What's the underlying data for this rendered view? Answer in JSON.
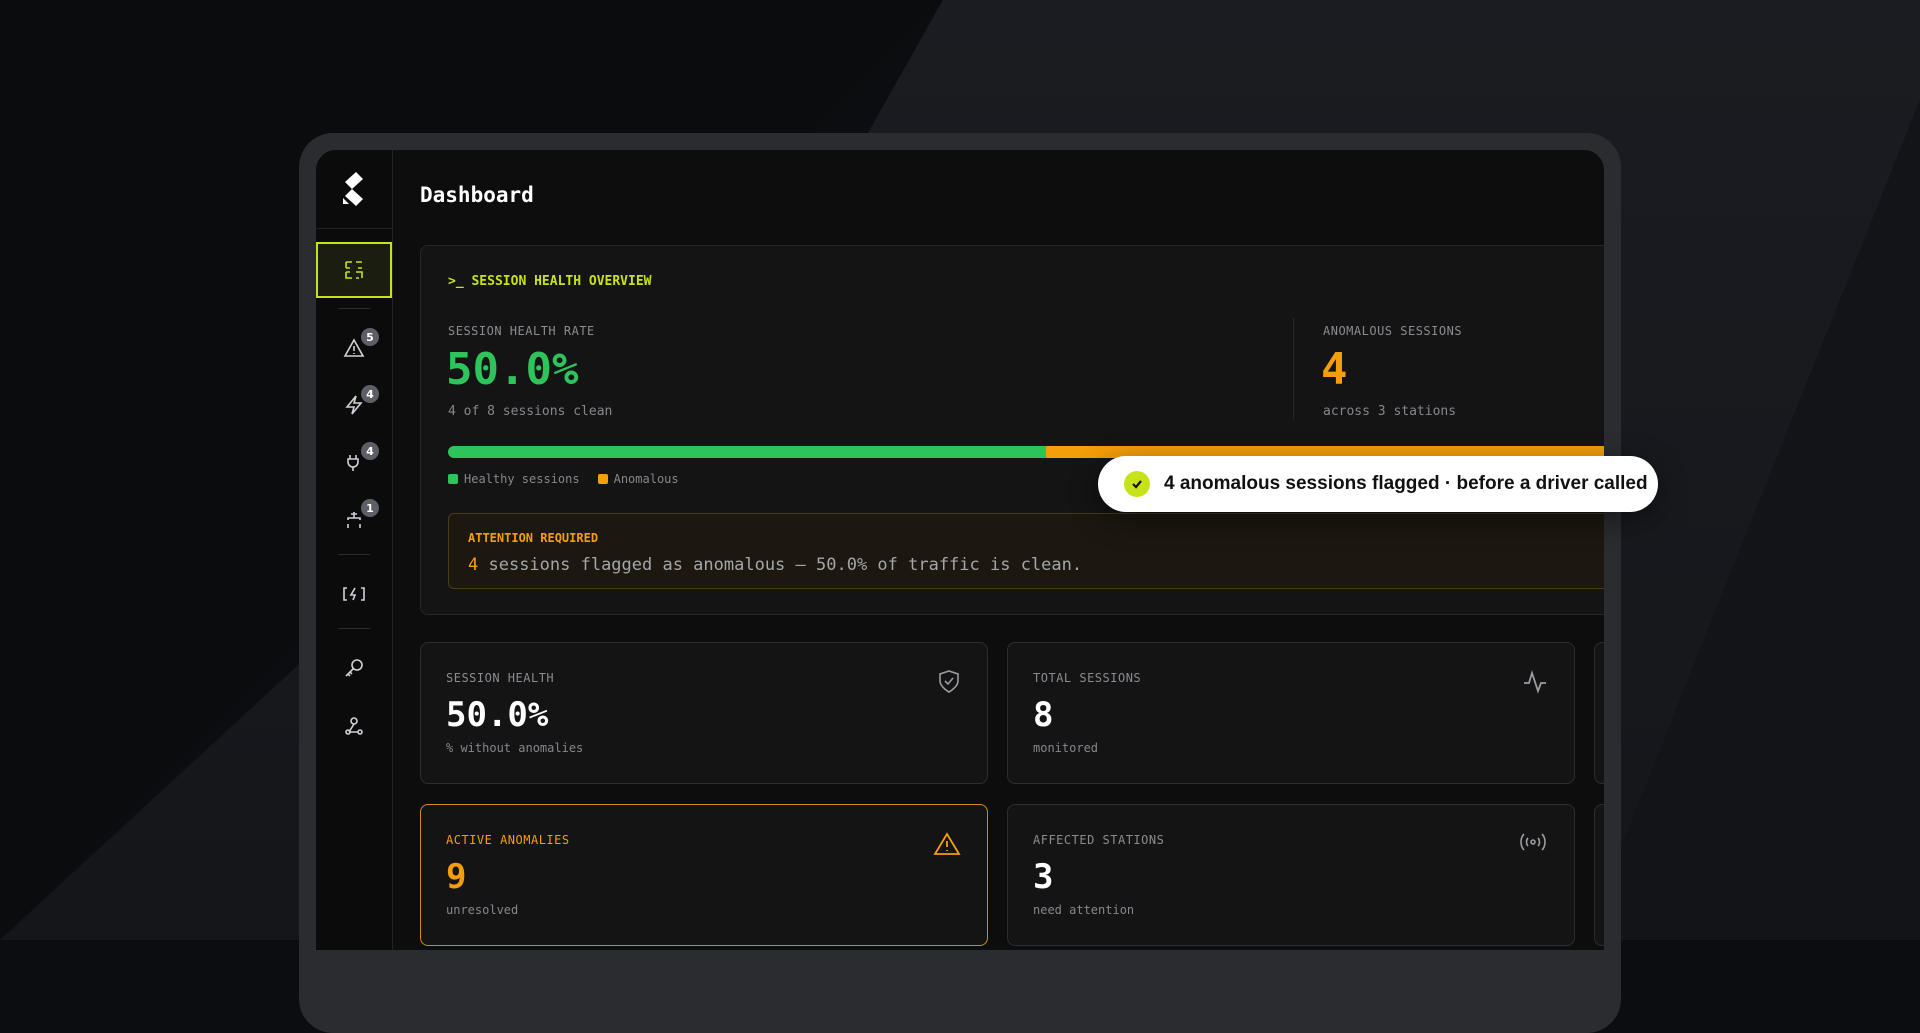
{
  "page": {
    "title": "Dashboard"
  },
  "sidebar": {
    "items": [
      {
        "icon": "dashboard-icon",
        "active": true
      },
      {
        "icon": "alert-triangle-icon",
        "badge": "5"
      },
      {
        "icon": "lightning-icon",
        "badge": "4"
      },
      {
        "icon": "plug-icon",
        "badge": "4"
      },
      {
        "icon": "connector-icon",
        "badge": "1"
      },
      {
        "icon": "charger-icon"
      },
      {
        "icon": "key-icon"
      },
      {
        "icon": "webhook-icon"
      }
    ]
  },
  "overview": {
    "heading": ">_ SESSION HEALTH OVERVIEW",
    "health_label": "SESSION HEALTH RATE",
    "health_value": "50.0%",
    "health_sub": "4 of 8 sessions clean",
    "anomalous_label": "ANOMALOUS SESSIONS",
    "anomalous_value": "4",
    "anomalous_sub": "across 3 stations",
    "healthy_fraction": 0.5,
    "legend_healthy": "Healthy sessions",
    "legend_anomalous": "Anomalous",
    "attention_title": "ATTENTION REQUIRED",
    "attention_count": "4",
    "attention_message": " sessions flagged as anomalous — 50.0% of traffic is clean."
  },
  "cards": {
    "health": {
      "label": "SESSION HEALTH",
      "value": "50.0%",
      "sub": "% without anomalies"
    },
    "total": {
      "label": "TOTAL SESSIONS",
      "value": "8",
      "sub": "monitored"
    },
    "anomalies": {
      "label": "ACTIVE ANOMALIES",
      "value": "9",
      "sub": "unresolved"
    },
    "stations": {
      "label": "AFFECTED STATIONS",
      "value": "3",
      "sub": "need attention"
    }
  },
  "toast": {
    "text": "4 anomalous sessions flagged · before a driver called"
  },
  "colors": {
    "accent": "#c8e21a",
    "healthy": "#2fc45b",
    "anomalous": "#f59e0b"
  }
}
